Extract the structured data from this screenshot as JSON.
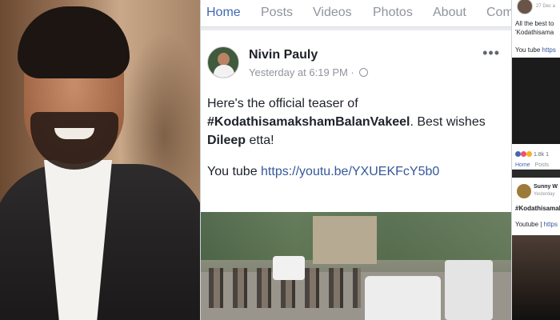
{
  "colors": {
    "facebook_blue": "#4267b2",
    "link_blue": "#365899",
    "text_dark": "#1d2129",
    "text_muted": "#90949c",
    "feed_bg": "#e9ebee"
  },
  "portrait": {
    "icon": "person-photo"
  },
  "tabs": [
    {
      "label": "Home",
      "active": true
    },
    {
      "label": "Posts"
    },
    {
      "label": "Videos"
    },
    {
      "label": "Photos"
    },
    {
      "label": "About"
    },
    {
      "label": "Com"
    }
  ],
  "post": {
    "author": "Nivin Pauly",
    "time": "Yesterday at 6:19 PM · ",
    "privacy_icon": "globe-icon",
    "more_icon": "•••",
    "text_prefix": "Here's the official teaser of ",
    "hashtag": "#KodathisamakshamBalanVakeel",
    "text_mid": ". Best wishes ",
    "mention": "Dileep",
    "text_suffix": " etta!",
    "link_label": "You tube ",
    "link_url": "https://youtu.be/YXUEKFcY5b0"
  },
  "right_panel": {
    "date_1": "27 Dec a",
    "line_1a": "All the best to",
    "line_1b": "'Kodathisama",
    "link_label_1": "You tube ",
    "link_1": "https",
    "reactions": "1.8k  1",
    "tab_1": "Home",
    "tab_2": "Posts",
    "name_2": "Sunny W",
    "date_2": "Yesterday",
    "line_2a": "#Kodathisamak",
    "link_label_2": "Youtube | ",
    "link_2": "https"
  }
}
